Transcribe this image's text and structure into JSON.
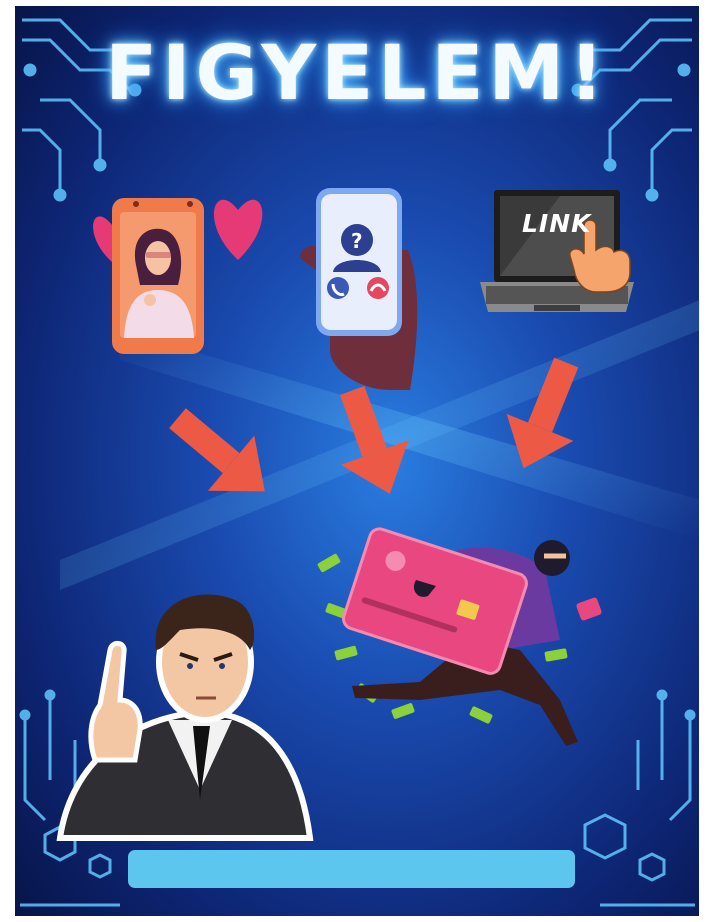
{
  "poster": {
    "title": "FIGYELEM!",
    "laptop_screen_text": "LINK"
  },
  "icons": [
    "heart-icon",
    "phone-icon",
    "call-accept-icon",
    "call-decline-icon",
    "unknown-caller-icon",
    "laptop-icon",
    "pointing-hand-icon",
    "arrow-icon",
    "credit-card-icon",
    "thief-icon",
    "money-icon",
    "businessman-icon"
  ],
  "colors": {
    "background_dark": "#0a1a52",
    "background_glow": "#1e63c9",
    "circuit": "#5fc8ff",
    "arrow": "#ec5a45",
    "card": "#e8477f",
    "caption_bar": "#5cc6ee"
  }
}
